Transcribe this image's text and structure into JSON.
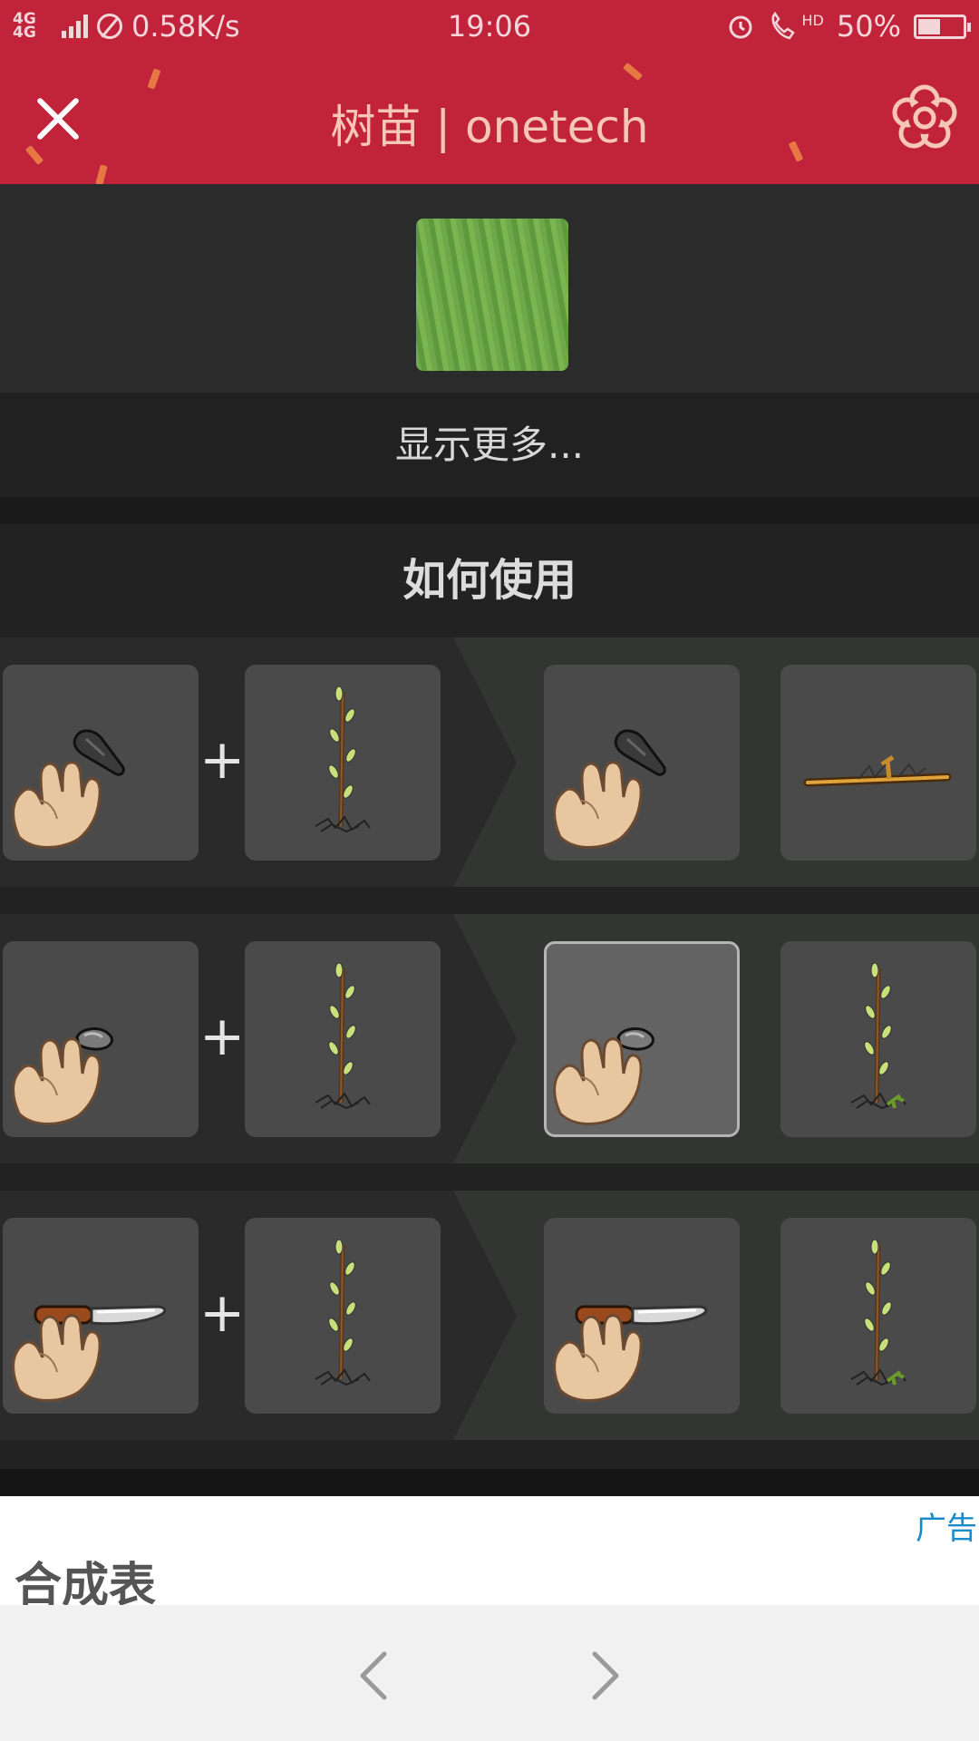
{
  "status": {
    "network": "4G 4G",
    "speed": "0.58K/s",
    "time": "19:06",
    "hd": "HD",
    "battery": "50%"
  },
  "header": {
    "title": "树苗 | onetech",
    "close_icon": "close-icon",
    "menu_icon": "flower-icon",
    "color": "#c0233a"
  },
  "item": {
    "image_icon": "grass-texture-icon"
  },
  "more_label": "显示更多...",
  "section": {
    "title": "如何使用"
  },
  "recipes": [
    {
      "inputs": [
        "hand-sharp-stone-icon",
        "sapling-icon"
      ],
      "outputs": [
        "hand-sharp-stone-icon",
        "cut-branch-icon"
      ]
    },
    {
      "inputs": [
        "hand-round-stone-icon",
        "sapling-icon"
      ],
      "outputs": [
        "hand-round-stone-icon",
        "sapling-with-cutting-icon"
      ],
      "selected": "output-0"
    },
    {
      "inputs": [
        "hand-knife-icon",
        "sapling-icon"
      ],
      "outputs": [
        "hand-knife-icon",
        "sapling-with-cutting-icon"
      ]
    }
  ],
  "plus": "+",
  "ad": {
    "label": "广告",
    "title": "合成表"
  },
  "nav": {
    "back_icon": "chevron-left-icon",
    "forward_icon": "chevron-right-icon"
  }
}
